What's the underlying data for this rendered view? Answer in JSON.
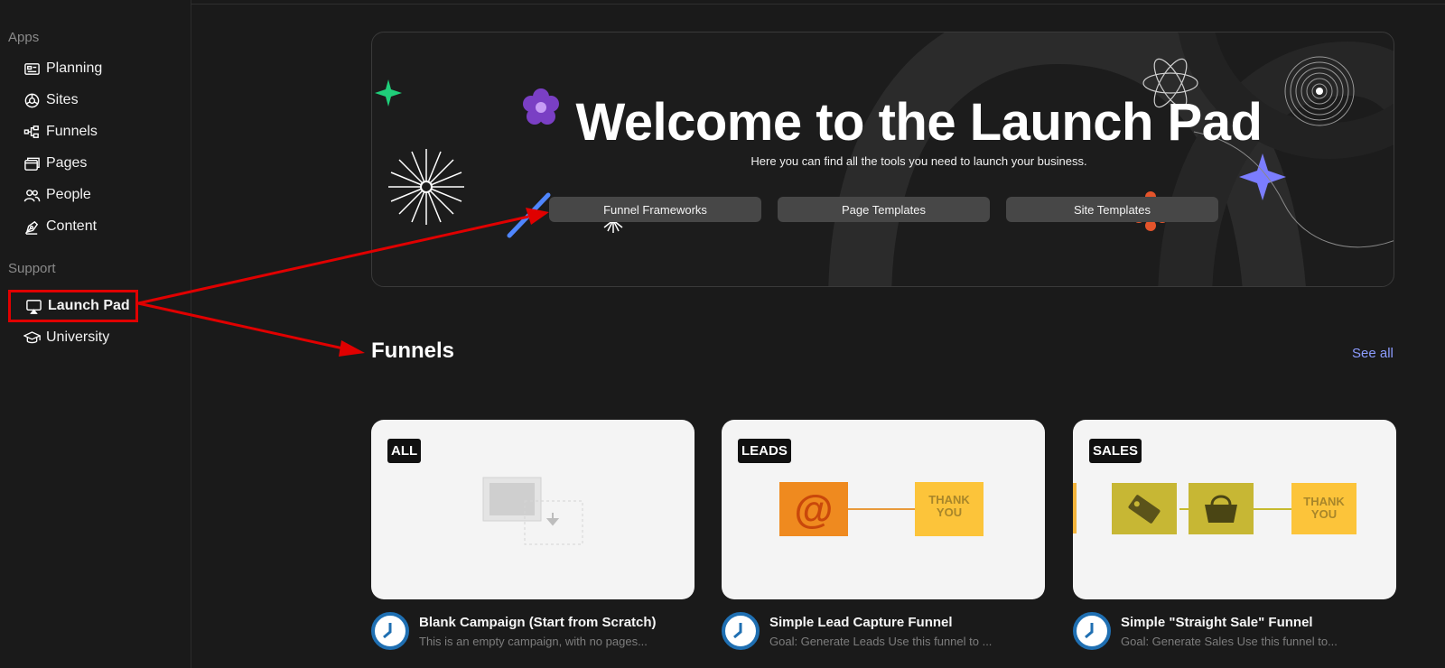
{
  "sidebar": {
    "apps_label": "Apps",
    "apps": [
      {
        "label": "Planning",
        "icon": "planning-icon"
      },
      {
        "label": "Sites",
        "icon": "sites-icon"
      },
      {
        "label": "Funnels",
        "icon": "funnels-icon"
      },
      {
        "label": "Pages",
        "icon": "pages-icon"
      },
      {
        "label": "People",
        "icon": "people-icon"
      },
      {
        "label": "Content",
        "icon": "content-icon"
      }
    ],
    "support_label": "Support",
    "support": [
      {
        "label": "Launch Pad",
        "icon": "launchpad-icon",
        "active": true
      },
      {
        "label": "University",
        "icon": "university-icon"
      }
    ]
  },
  "hero": {
    "title": "Welcome to the Launch Pad",
    "subtitle": "Here you can find all the tools you need to launch your business.",
    "buttons": [
      "Funnel Frameworks",
      "Page Templates",
      "Site Templates"
    ]
  },
  "funnels": {
    "title": "Funnels",
    "see_all": "See all",
    "cards": [
      {
        "tag": "ALL",
        "title": "Blank Campaign (Start from Scratch)",
        "desc": "This is an empty campaign, with no pages..."
      },
      {
        "tag": "LEADS",
        "title": "Simple Lead Capture Funnel",
        "desc": "Goal: Generate Leads Use this funnel to ...",
        "thank_you": "THANK YOU"
      },
      {
        "tag": "SALES",
        "title": "Simple \"Straight Sale\" Funnel",
        "desc": "Goal: Generate Sales Use this funnel to...",
        "thank_you": "THANK YOU"
      }
    ]
  },
  "colors": {
    "accent_link": "#8c9cff",
    "annotation_red": "#e00000",
    "clock_blue": "#1f6fb2"
  }
}
